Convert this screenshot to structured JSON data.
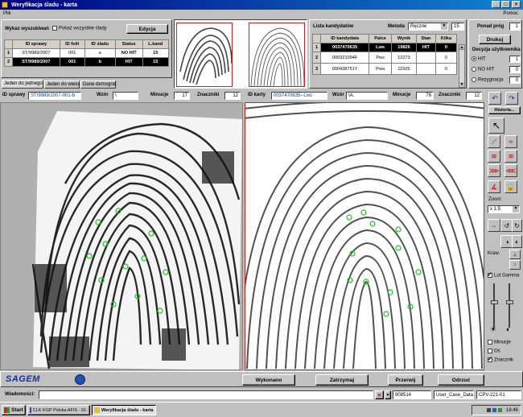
{
  "window": {
    "title": "Weryfikacja śladu - karta"
  },
  "menu": {
    "file": "Plik",
    "help": "Pomoc"
  },
  "search_panel": {
    "label": "Wykaz wyszukiwań",
    "show_all_label": "Pokaż wszystkie ślady",
    "edit_button": "Edycja",
    "headers": [
      "ID sprawy",
      "ID folii",
      "ID śladu",
      "Status",
      "L.kand"
    ],
    "rows": [
      {
        "no": "1",
        "cells": [
          "ST/9989/2007",
          "001",
          "a",
          "NO HIT",
          "15"
        ]
      },
      {
        "no": "2",
        "cells": [
          "ST/9989/2007",
          "001",
          "b",
          "HIT",
          "15"
        ]
      }
    ]
  },
  "candidates": {
    "label": "Lista kandydatów",
    "method_label": "Metoda",
    "method_value": "Ręczne",
    "method_count": "15",
    "headers": [
      "ID kandydata",
      "Palce",
      "Wynik",
      "Stan",
      "Kilka"
    ],
    "rows": [
      {
        "no": "1",
        "cells": [
          "0037470635",
          "Lws",
          "19826",
          "HIT",
          "0"
        ]
      },
      {
        "no": "2",
        "cells": [
          "000321094F",
          "Pws",
          "12273",
          "",
          "0"
        ]
      },
      {
        "no": "3",
        "cells": [
          "000438751Y",
          "Pwa",
          "11505",
          "",
          "0"
        ]
      }
    ]
  },
  "decision": {
    "threshold_label": "Ponad próg",
    "threshold_value": "1",
    "print_button": "Drukuj",
    "title": "Decyzja użytkownika",
    "options": [
      {
        "label": "HIT",
        "value": "1"
      },
      {
        "label": "NO HIT",
        "value": "0"
      },
      {
        "label": "Rezygnacja",
        "value": "0"
      }
    ]
  },
  "tabs": [
    "Jeden do jednego",
    "Jeden do wielu",
    "Dane demograf."
  ],
  "left_info": {
    "id_label": "ID sprawy",
    "id_value": "ST/9989/2007-001-b",
    "pattern_label": "Wzór",
    "pattern_value": "\\",
    "minutiae_label": "Minucje",
    "minutiae_value": "17",
    "markers_label": "Znaczniki",
    "markers_value": "12"
  },
  "right_info": {
    "id_label": "ID karty",
    "id_value": "0037470635--Lws",
    "pattern_label": "Wzór",
    "pattern_value": "\\A.",
    "minutiae_label": "Minucje",
    "minutiae_value": "78",
    "markers_label": "Znaczniki",
    "markers_value": "12"
  },
  "tools": {
    "history_button": "Historia...",
    "zoom_label": "Zoom:",
    "zoom_value": "x 1.5",
    "draw_label": "Kraw.",
    "lut_label": "Lut Gamma",
    "checkboxes": [
      {
        "label": "Minucje",
        "checked": false
      },
      {
        "label": "Oś",
        "checked": false
      },
      {
        "label": "Znacznik",
        "checked": true
      }
    ]
  },
  "bottom": {
    "logo": "SAGEM",
    "buttons": [
      "Wykonano",
      "Zatrzymaj",
      "Przerwij",
      "Odrzuć"
    ]
  },
  "status": {
    "messages_label": "Wiadomości:",
    "field1": "908514",
    "field2": "User_Case_Data",
    "field3": "CPV-221-01"
  },
  "taskbar": {
    "start": "Start",
    "task1": "CLK KGP Polska AFIS - Gl...",
    "task2": "Weryfikacja śladu - karta",
    "clock": "18:46"
  }
}
